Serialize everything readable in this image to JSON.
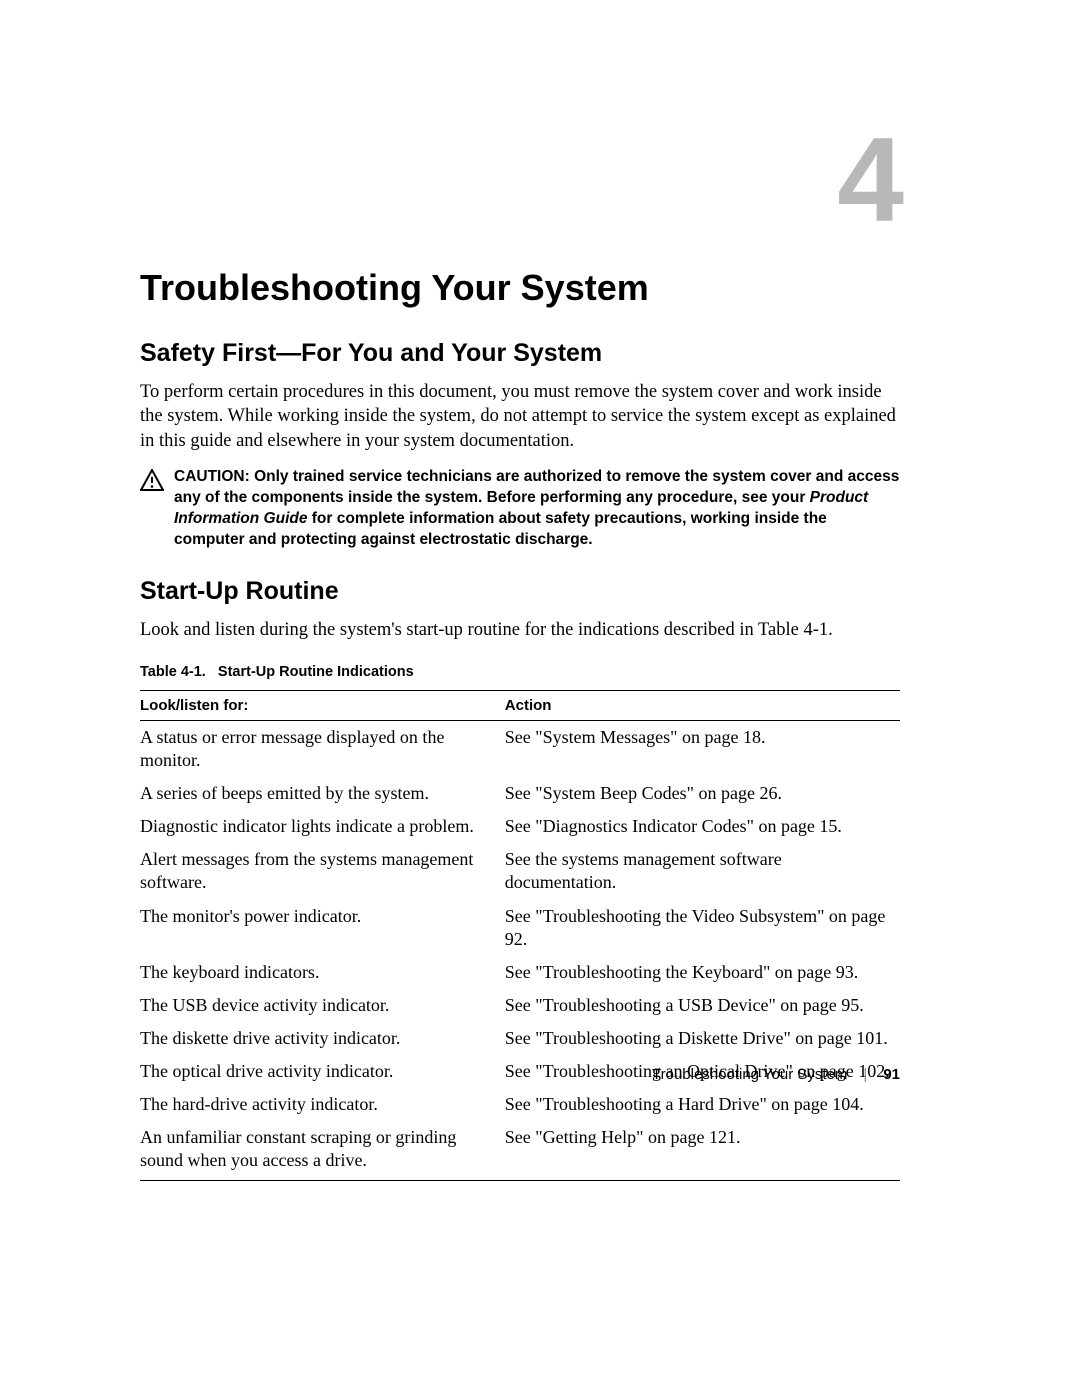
{
  "chapter": {
    "number": "4",
    "title": "Troubleshooting Your System"
  },
  "sections": {
    "safety": {
      "heading": "Safety First—For You and Your System",
      "paragraph": "To perform certain procedures in this document, you must remove the system cover and work inside the system. While working inside the system, do not attempt to service the system except as explained in this guide and elsewhere in your system documentation.",
      "caution_label": "CAUTION:",
      "caution_pre": " Only trained service technicians are authorized to remove the system cover and access any of the components inside the system. Before performing any procedure, see your ",
      "caution_italic": "Product Information Guide",
      "caution_post": " for complete information about safety precautions, working inside the computer and protecting against electrostatic discharge."
    },
    "startup": {
      "heading": "Start-Up Routine",
      "paragraph": "Look and listen during the system's start-up routine for the indications described in Table 4-1.",
      "table_caption_label": "Table 4-1.",
      "table_caption_text": "Start-Up Routine Indications",
      "table": {
        "headers": {
          "col1": "Look/listen for:",
          "col2": "Action"
        },
        "rows": [
          {
            "look": "A status or error message displayed on the monitor.",
            "action": "See \"System Messages\" on page 18."
          },
          {
            "look": "A series of beeps emitted by the system.",
            "action": "See \"System Beep Codes\" on page 26."
          },
          {
            "look": "Diagnostic indicator lights indicate a problem.",
            "action": "See \"Diagnostics Indicator Codes\" on page 15."
          },
          {
            "look": "Alert messages from the systems management software.",
            "action": "See the systems management software documentation."
          },
          {
            "look": "The monitor's power indicator.",
            "action": "See \"Troubleshooting the Video Subsystem\" on page 92."
          },
          {
            "look": "The keyboard indicators.",
            "action": "See \"Troubleshooting the Keyboard\" on page 93."
          },
          {
            "look": "The USB device activity indicator.",
            "action": "See \"Troubleshooting a USB Device\" on page 95."
          },
          {
            "look": "The diskette drive activity indicator.",
            "action": "See \"Troubleshooting a Diskette Drive\" on page 101."
          },
          {
            "look": "The optical drive activity indicator.",
            "action": "See \"Troubleshooting an Optical Drive\" on page 102."
          },
          {
            "look": "The hard-drive activity indicator.",
            "action": "See \"Troubleshooting a Hard Drive\" on page 104."
          },
          {
            "look": "An unfamiliar constant scraping or grinding sound when you access a drive.",
            "action": "See \"Getting Help\" on page 121."
          }
        ]
      }
    }
  },
  "footer": {
    "section": "Troubleshooting Your System",
    "page": "91"
  }
}
